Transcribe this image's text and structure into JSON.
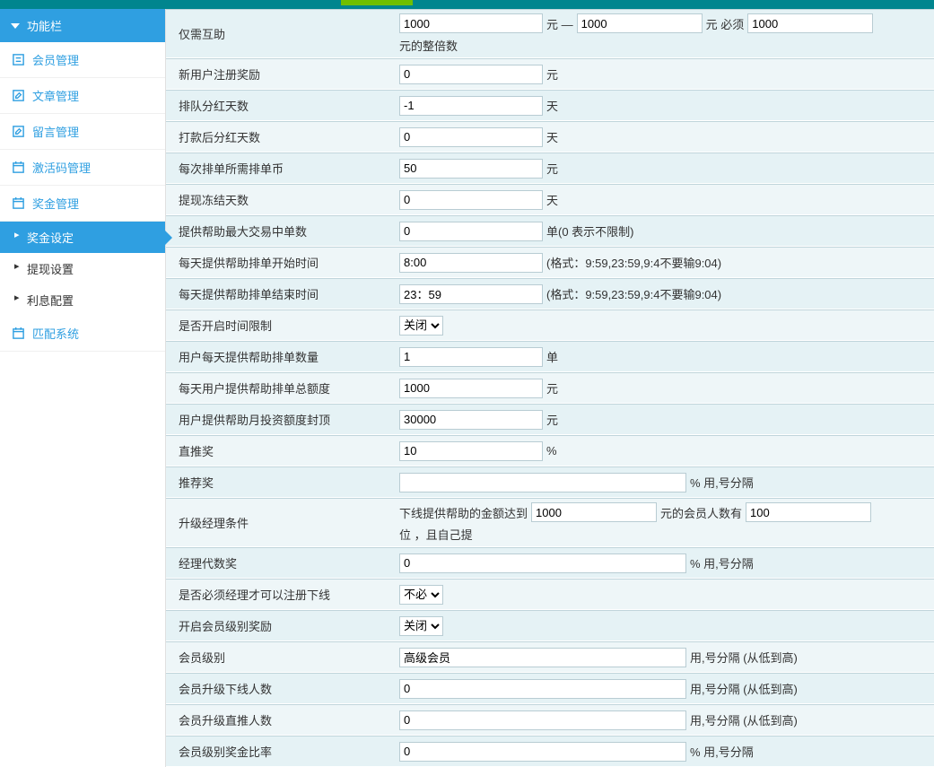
{
  "sidebar": {
    "header": "功能栏",
    "items": [
      {
        "label": "会员管理"
      },
      {
        "label": "文章管理"
      },
      {
        "label": "留言管理"
      },
      {
        "label": "激活码管理"
      },
      {
        "label": "奖金管理"
      },
      {
        "label": "匹配系统"
      }
    ],
    "submenu": {
      "active": "奖金设定",
      "items": [
        "提现设置",
        "利息配置"
      ]
    }
  },
  "form": {
    "row1": {
      "label": "仅需互助",
      "v1": "1000",
      "unit1": "元 —",
      "v2": "1000",
      "unit2": "元 必须",
      "v3": "1000",
      "unit3": "元的整倍数"
    },
    "row2": {
      "label": "新用户注册奖励",
      "value": "0",
      "unit": "元"
    },
    "row3": {
      "label": "排队分红天数",
      "value": "-1",
      "unit": "天"
    },
    "row4": {
      "label": "打款后分红天数",
      "value": "0",
      "unit": "天"
    },
    "row5": {
      "label": "每次排单所需排单币",
      "value": "50",
      "unit": "元"
    },
    "row6": {
      "label": "提现冻结天数",
      "value": "0",
      "unit": "天"
    },
    "row7": {
      "label": "提供帮助最大交易中单数",
      "value": "0",
      "unit": "单(0 表示不限制)"
    },
    "row8": {
      "label": "每天提供帮助排单开始时间",
      "value": "8:00",
      "hint": "(格式：9:59,23:59,9:4不要输9:04)"
    },
    "row9": {
      "label": "每天提供帮助排单结束时间",
      "value": "23：59",
      "hint": "(格式：9:59,23:59,9:4不要输9:04)"
    },
    "row10": {
      "label": "是否开启时间限制",
      "value": "关闭"
    },
    "row11": {
      "label": "用户每天提供帮助排单数量",
      "value": "1",
      "unit": "单"
    },
    "row12": {
      "label": "每天用户提供帮助排单总额度",
      "value": "1000",
      "unit": "元"
    },
    "row13": {
      "label": "用户提供帮助月投资额度封顶",
      "value": "30000",
      "unit": "元"
    },
    "row14": {
      "label": "直推奖",
      "value": "10",
      "unit": "%"
    },
    "row15": {
      "label": "推荐奖",
      "value": "",
      "unit": "% 用,号分隔"
    },
    "row16": {
      "label": "升级经理条件",
      "pre": "下线提供帮助的金额达到",
      "v1": "1000",
      "mid": "元的会员人数有",
      "v2": "100",
      "post": "位 ，且自己提"
    },
    "row17": {
      "label": "经理代数奖",
      "value": "0",
      "unit": "% 用,号分隔"
    },
    "row18": {
      "label": "是否必须经理才可以注册下线",
      "value": "不必"
    },
    "row19": {
      "label": "开启会员级别奖励",
      "value": "关闭"
    },
    "row20": {
      "label": "会员级别",
      "value": "高级会员",
      "unit": "用,号分隔 (从低到高)"
    },
    "row21": {
      "label": "会员升级下线人数",
      "value": "0",
      "unit": "用,号分隔 (从低到高)"
    },
    "row22": {
      "label": "会员升级直推人数",
      "value": "0",
      "unit": "用,号分隔 (从低到高)"
    },
    "row23": {
      "label": "会员级别奖金比率",
      "value": "0",
      "unit": "% 用,号分隔"
    }
  }
}
